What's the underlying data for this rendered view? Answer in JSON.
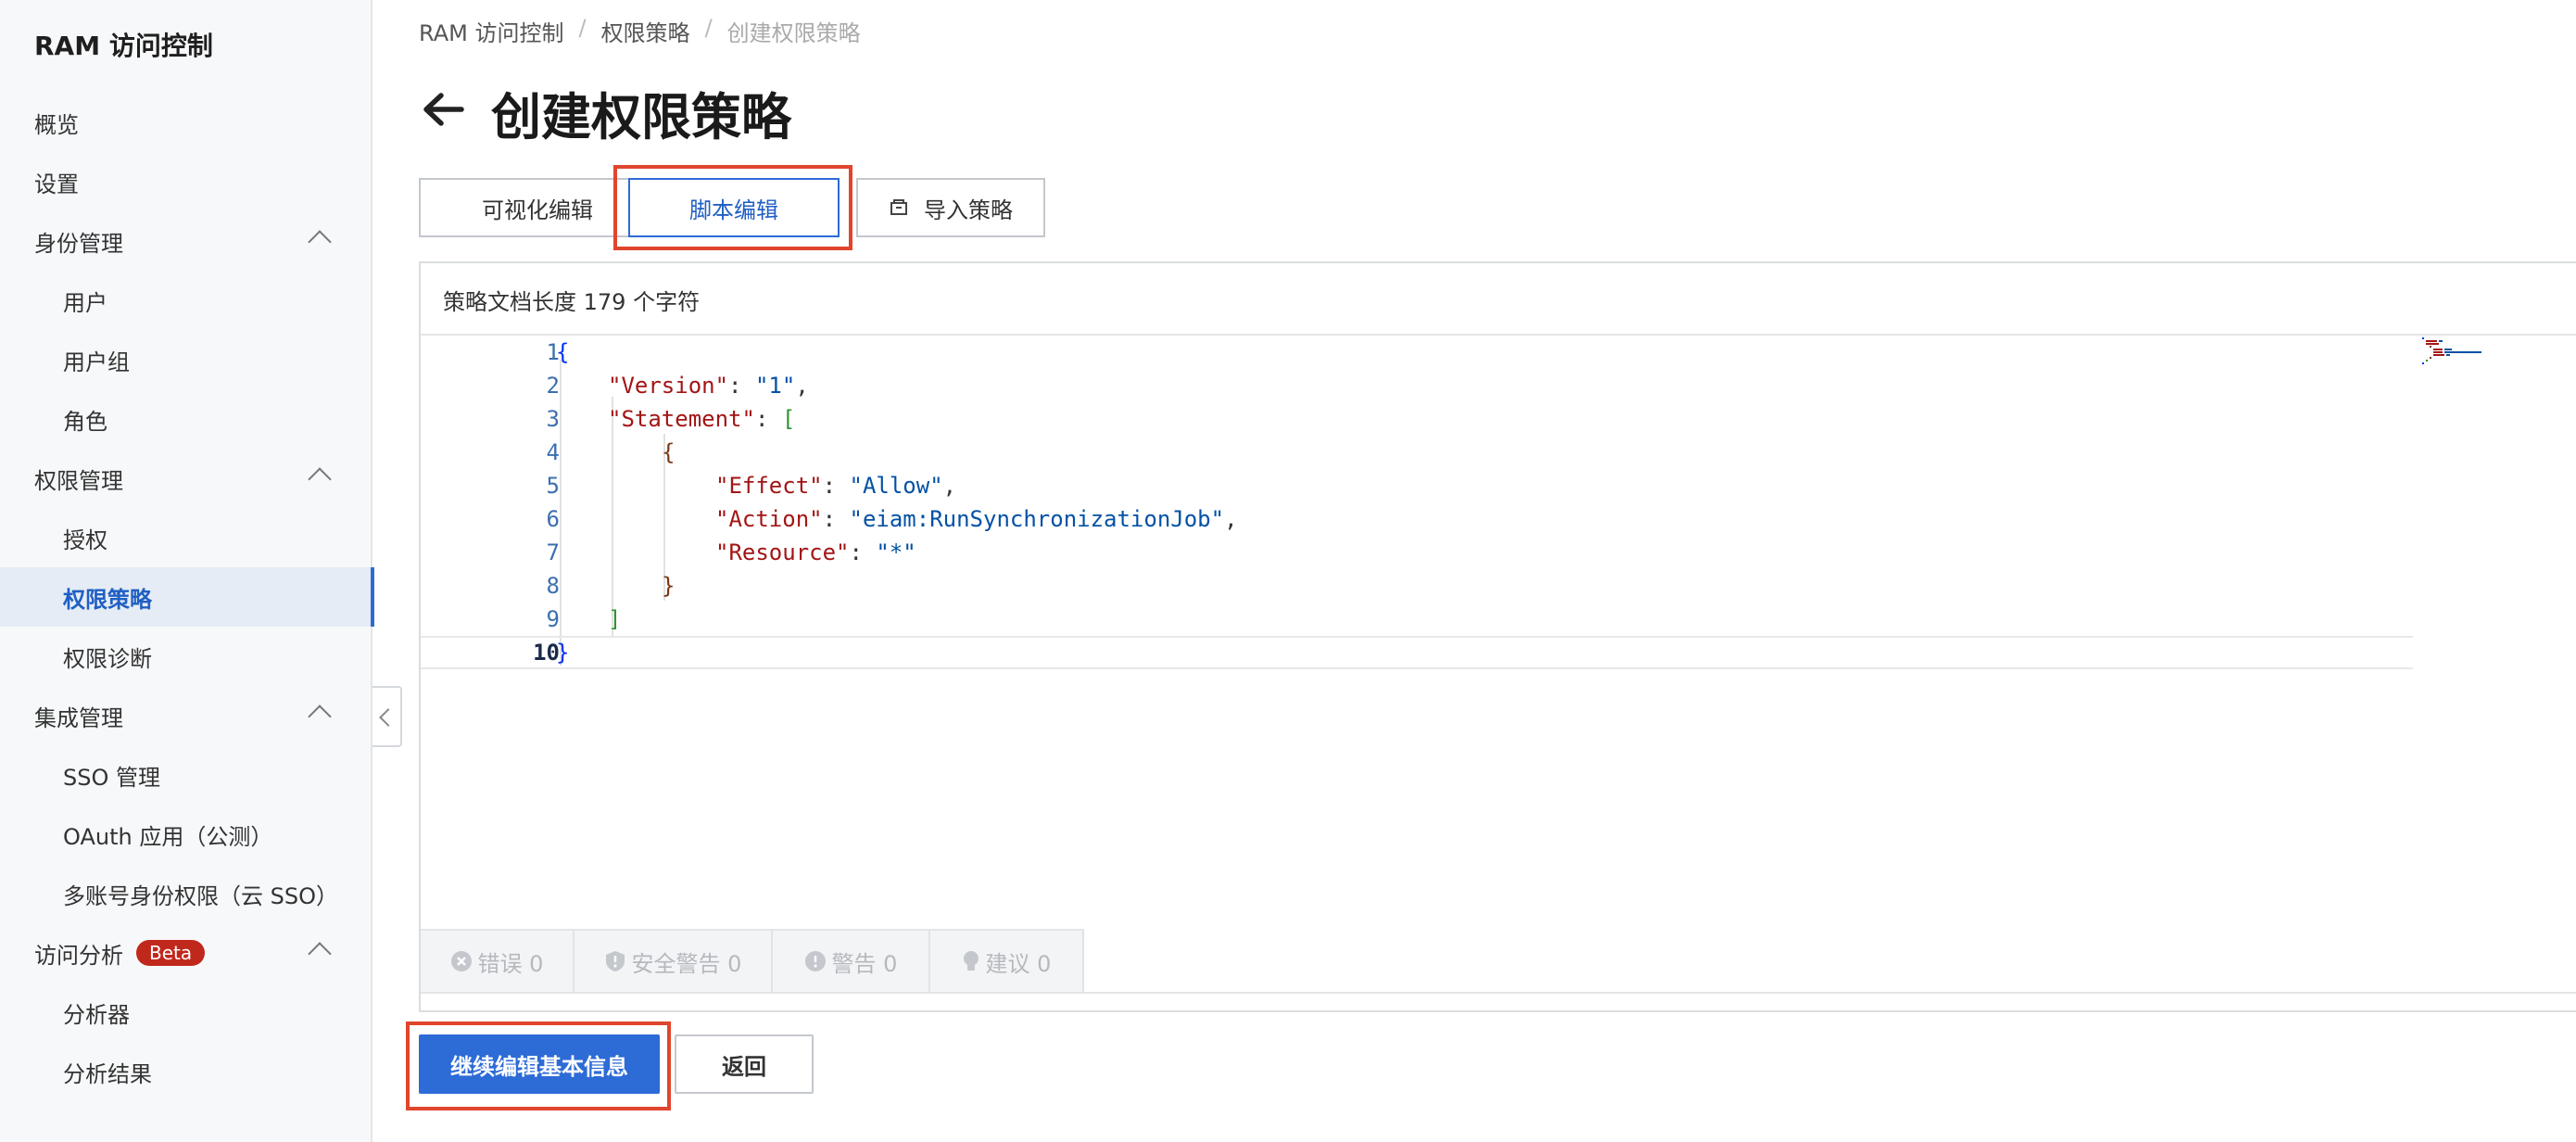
{
  "sidebar": {
    "title": "RAM 访问控制",
    "items": [
      {
        "label": "概览"
      },
      {
        "label": "设置"
      },
      {
        "label": "身份管理"
      },
      {
        "label": "用户"
      },
      {
        "label": "用户组"
      },
      {
        "label": "角色"
      },
      {
        "label": "权限管理"
      },
      {
        "label": "授权"
      },
      {
        "label": "权限策略"
      },
      {
        "label": "权限诊断"
      },
      {
        "label": "集成管理"
      },
      {
        "label": "SSO 管理"
      },
      {
        "label": "OAuth 应用（公测）"
      },
      {
        "label": "多账号身份权限（云 SSO）"
      },
      {
        "label": "访问分析",
        "badge": "Beta"
      },
      {
        "label": "分析器"
      },
      {
        "label": "分析结果"
      }
    ],
    "active_item": "权限策略"
  },
  "breadcrumb": [
    "RAM 访问控制",
    "权限策略",
    "创建权限策略"
  ],
  "page_title": "创建权限策略",
  "tabs": [
    {
      "label": "可视化编辑"
    },
    {
      "label": "脚本编辑",
      "selected": true
    },
    {
      "label": "导入策略",
      "icon": "import-icon"
    }
  ],
  "editor": {
    "doc_length_text": "策略文档长度 179 个字符",
    "line_numbers": [
      "1",
      "2",
      "3",
      "4",
      "5",
      "6",
      "7",
      "8",
      "9",
      "10"
    ],
    "code": {
      "l1_open": "{",
      "version_key": "\"Version\"",
      "version_val": "\"1\"",
      "statement_key": "\"Statement\"",
      "arr_open": "[",
      "obj_open": "{",
      "effect_key": "\"Effect\"",
      "effect_val": "\"Allow\"",
      "action_key": "\"Action\"",
      "action_val": "\"eiam:RunSynchronizationJob\"",
      "resource_key": "\"Resource\"",
      "resource_val": "\"*\"",
      "obj_close": "}",
      "arr_close": "]",
      "l10_close": "}"
    }
  },
  "diagnostics": [
    {
      "label": "错误 0",
      "icon": "error-icon"
    },
    {
      "label": "安全警告 0",
      "icon": "shield-warning-icon"
    },
    {
      "label": "警告 0",
      "icon": "warning-icon"
    },
    {
      "label": "建议 0",
      "icon": "bulb-icon"
    }
  ],
  "actions": {
    "continue_label": "继续编辑基本信息",
    "back_label": "返回"
  },
  "colors": {
    "primary": "#2d6bd6",
    "highlight": "#e0452d",
    "beta_badge": "#c0281b"
  }
}
